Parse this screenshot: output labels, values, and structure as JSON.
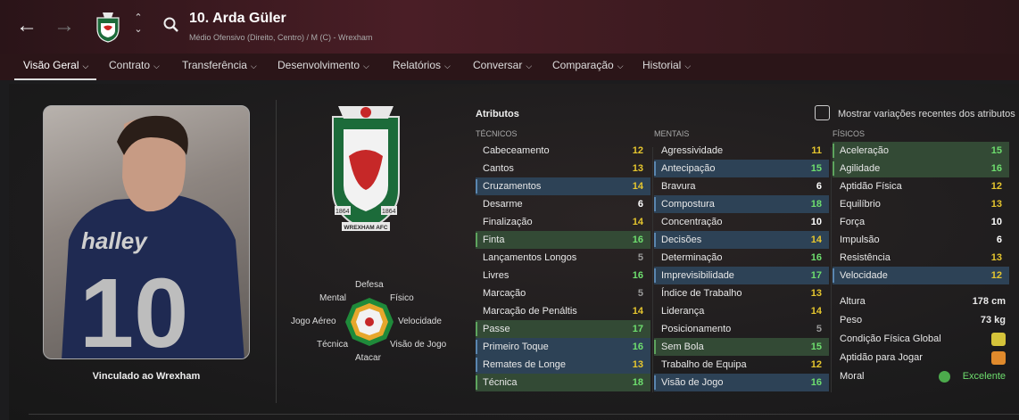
{
  "header": {
    "player_name": "10. Arda Güler",
    "player_subtitle": "Médio Ofensivo (Direito, Centro) / M (C) - Wrexham",
    "back_icon": "arrow-left-icon",
    "forward_icon": "arrow-right-icon",
    "crest_icon": "wrexham-crest-icon",
    "updown_icon": "up-down-chevron-icon",
    "search_icon": "search-icon"
  },
  "nav": {
    "items": [
      {
        "label": "Visão Geral",
        "active": true
      },
      {
        "label": "Contrato"
      },
      {
        "label": "Transferência"
      },
      {
        "label": "Desenvolvimento"
      },
      {
        "label": "Relatórios"
      },
      {
        "label": "Conversar"
      },
      {
        "label": "Comparação"
      },
      {
        "label": "Historial"
      }
    ]
  },
  "profile": {
    "loan_text": "Vinculado ao Wrexham",
    "crest_texts": {
      "year_left": "1864",
      "year_right": "1864",
      "banner": "WREXHAM AFC"
    }
  },
  "positions": {
    "defesa": "Defesa",
    "mental": "Mental",
    "fisico": "Físico",
    "jogo_aereo": "Jogo Aéreo",
    "velocidade": "Velocidade",
    "tecnica": "Técnica",
    "visao_de_jogo": "Visão de Jogo",
    "atacar": "Atacar"
  },
  "attributes": {
    "title": "Atributos",
    "show_variations_label": "Mostrar variações recentes dos atributos",
    "tecnicos": {
      "header": "TÉCNICOS",
      "rows": [
        {
          "label": "Cabeceamento",
          "value": "12",
          "hl": ""
        },
        {
          "label": "Cantos",
          "value": "13",
          "hl": ""
        },
        {
          "label": "Cruzamentos",
          "value": "14",
          "hl": "blue"
        },
        {
          "label": "Desarme",
          "value": "6",
          "hl": ""
        },
        {
          "label": "Finalização",
          "value": "14",
          "hl": ""
        },
        {
          "label": "Finta",
          "value": "16",
          "hl": "green"
        },
        {
          "label": "Lançamentos Longos",
          "value": "5",
          "hl": ""
        },
        {
          "label": "Livres",
          "value": "16",
          "hl": ""
        },
        {
          "label": "Marcação",
          "value": "5",
          "hl": ""
        },
        {
          "label": "Marcação de Penáltis",
          "value": "14",
          "hl": ""
        },
        {
          "label": "Passe",
          "value": "17",
          "hl": "green"
        },
        {
          "label": "Primeiro Toque",
          "value": "16",
          "hl": "blue"
        },
        {
          "label": "Remates de Longe",
          "value": "13",
          "hl": "blue"
        },
        {
          "label": "Técnica",
          "value": "18",
          "hl": "green"
        }
      ]
    },
    "mentais": {
      "header": "MENTAIS",
      "rows": [
        {
          "label": "Agressividade",
          "value": "11",
          "hl": ""
        },
        {
          "label": "Antecipação",
          "value": "15",
          "hl": "blue"
        },
        {
          "label": "Bravura",
          "value": "6",
          "hl": ""
        },
        {
          "label": "Compostura",
          "value": "18",
          "hl": "blue"
        },
        {
          "label": "Concentração",
          "value": "10",
          "hl": ""
        },
        {
          "label": "Decisões",
          "value": "14",
          "hl": "blue"
        },
        {
          "label": "Determinação",
          "value": "16",
          "hl": ""
        },
        {
          "label": "Imprevisibilidade",
          "value": "17",
          "hl": "blue"
        },
        {
          "label": "Índice de Trabalho",
          "value": "13",
          "hl": ""
        },
        {
          "label": "Liderança",
          "value": "14",
          "hl": ""
        },
        {
          "label": "Posicionamento",
          "value": "5",
          "hl": ""
        },
        {
          "label": "Sem Bola",
          "value": "15",
          "hl": "green"
        },
        {
          "label": "Trabalho de Equipa",
          "value": "12",
          "hl": ""
        },
        {
          "label": "Visão de Jogo",
          "value": "16",
          "hl": "blue"
        }
      ]
    },
    "fisicos": {
      "header": "FÍSICOS",
      "rows": [
        {
          "label": "Aceleração",
          "value": "15",
          "hl": "green"
        },
        {
          "label": "Agilidade",
          "value": "16",
          "hl": "green"
        },
        {
          "label": "Aptidão Física",
          "value": "12",
          "hl": ""
        },
        {
          "label": "Equilíbrio",
          "value": "13",
          "hl": ""
        },
        {
          "label": "Força",
          "value": "10",
          "hl": ""
        },
        {
          "label": "Impulsão",
          "value": "6",
          "hl": ""
        },
        {
          "label": "Resistência",
          "value": "13",
          "hl": ""
        },
        {
          "label": "Velocidade",
          "value": "12",
          "hl": "blue"
        }
      ]
    },
    "info": {
      "altura_label": "Altura",
      "altura_value": "178 cm",
      "peso_label": "Peso",
      "peso_value": "73 kg",
      "condicao_label": "Condição Física Global",
      "aptidao_label": "Aptidão para Jogar",
      "moral_label": "Moral",
      "moral_value": "Excelente"
    }
  },
  "colors": {
    "value_white": "#ffffff",
    "value_yellow": "#e6c62e",
    "value_green": "#6ede6e",
    "value_grey": "#9a9a9a"
  }
}
